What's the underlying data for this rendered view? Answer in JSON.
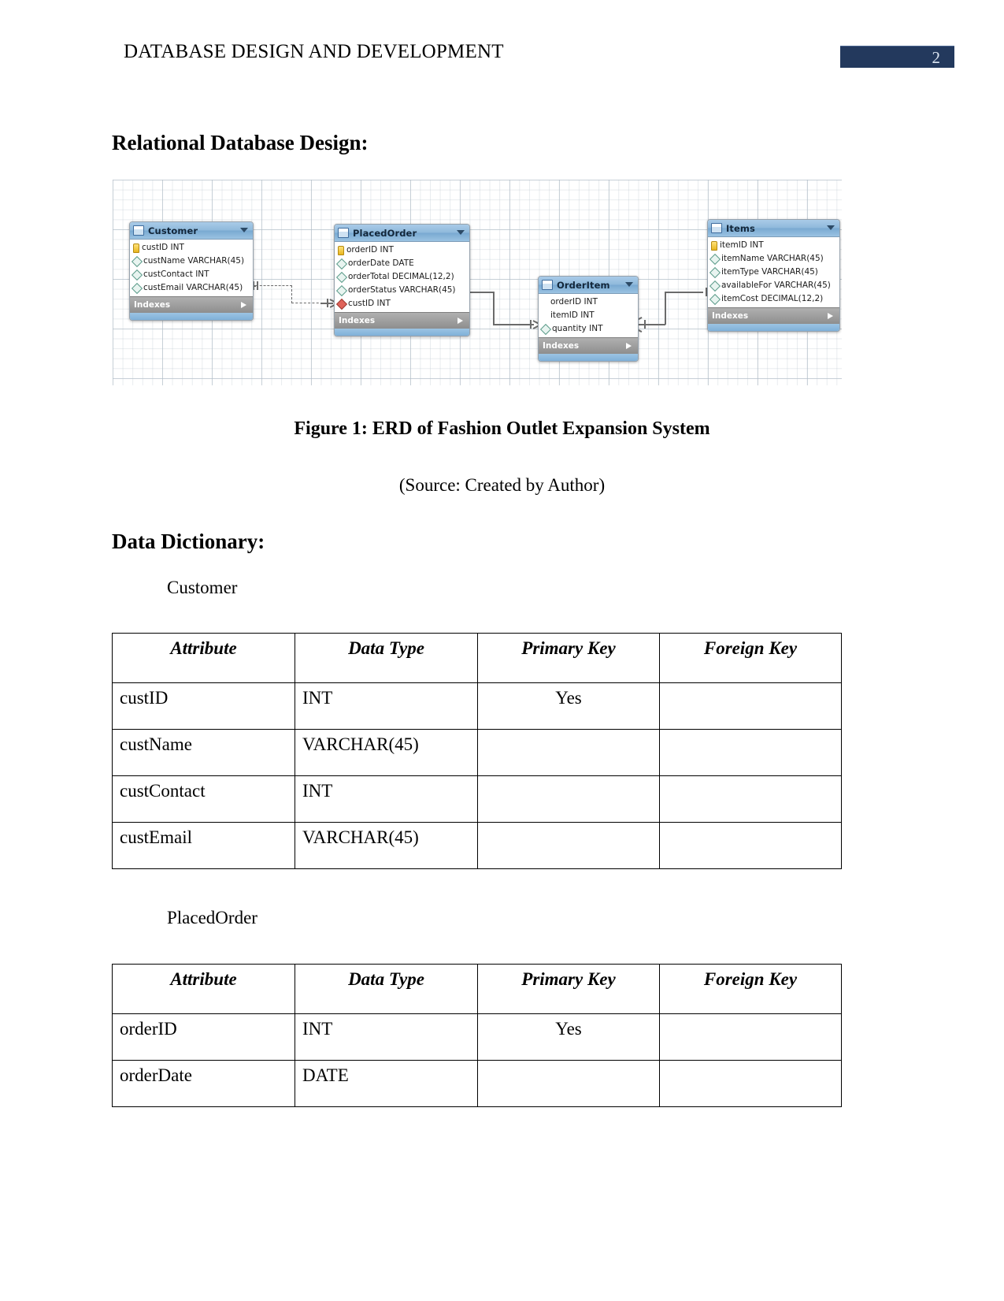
{
  "header": {
    "title": "DATABASE DESIGN AND DEVELOPMENT",
    "page_number": "2",
    "badge_color": "#23395d"
  },
  "sections": {
    "relational_database_design": "Relational Database Design:",
    "data_dictionary": "Data Dictionary:"
  },
  "figure": {
    "caption": "Figure 1: ERD of Fashion Outlet Expansion System",
    "source": "(Source: Created by Author)"
  },
  "erd": {
    "indexes_label": "Indexes",
    "tables": [
      {
        "name": "Customer",
        "columns": [
          {
            "text": "custID INT",
            "icon": "primary-key-icon"
          },
          {
            "text": "custName VARCHAR(45)",
            "icon": "column-diamond-icon"
          },
          {
            "text": "custContact INT",
            "icon": "column-diamond-icon"
          },
          {
            "text": "custEmail VARCHAR(45)",
            "icon": "column-diamond-icon"
          }
        ]
      },
      {
        "name": "PlacedOrder",
        "columns": [
          {
            "text": "orderID INT",
            "icon": "primary-key-icon"
          },
          {
            "text": "orderDate DATE",
            "icon": "column-diamond-icon"
          },
          {
            "text": "orderTotal DECIMAL(12,2)",
            "icon": "column-diamond-icon"
          },
          {
            "text": "orderStatus VARCHAR(45)",
            "icon": "column-diamond-icon"
          },
          {
            "text": "custID INT",
            "icon": "foreign-key-diamond-icon"
          }
        ]
      },
      {
        "name": "OrderItem",
        "columns": [
          {
            "text": "orderID INT",
            "icon": "none"
          },
          {
            "text": "itemID INT",
            "icon": "none"
          },
          {
            "text": "quantity INT",
            "icon": "column-diamond-icon"
          }
        ]
      },
      {
        "name": "Items",
        "columns": [
          {
            "text": "itemID INT",
            "icon": "primary-key-icon"
          },
          {
            "text": "itemName VARCHAR(45)",
            "icon": "column-diamond-icon"
          },
          {
            "text": "itemType VARCHAR(45)",
            "icon": "column-diamond-icon"
          },
          {
            "text": "availableFor VARCHAR(45)",
            "icon": "column-diamond-icon"
          },
          {
            "text": "itemCost DECIMAL(12,2)",
            "icon": "column-diamond-icon"
          }
        ]
      }
    ]
  },
  "data_dictionary": {
    "headers": [
      "Attribute",
      "Data Type",
      "Primary Key",
      "Foreign Key"
    ],
    "entities": [
      {
        "label": "Customer",
        "rows": [
          {
            "attribute": "custID",
            "data_type": "INT",
            "primary_key": "Yes",
            "foreign_key": ""
          },
          {
            "attribute": "custName",
            "data_type": "VARCHAR(45)",
            "primary_key": "",
            "foreign_key": ""
          },
          {
            "attribute": "custContact",
            "data_type": "INT",
            "primary_key": "",
            "foreign_key": ""
          },
          {
            "attribute": "custEmail",
            "data_type": "VARCHAR(45)",
            "primary_key": "",
            "foreign_key": ""
          }
        ]
      },
      {
        "label": "PlacedOrder",
        "rows": [
          {
            "attribute": "orderID",
            "data_type": "INT",
            "primary_key": "Yes",
            "foreign_key": ""
          },
          {
            "attribute": "orderDate",
            "data_type": "DATE",
            "primary_key": "",
            "foreign_key": ""
          }
        ]
      }
    ]
  }
}
